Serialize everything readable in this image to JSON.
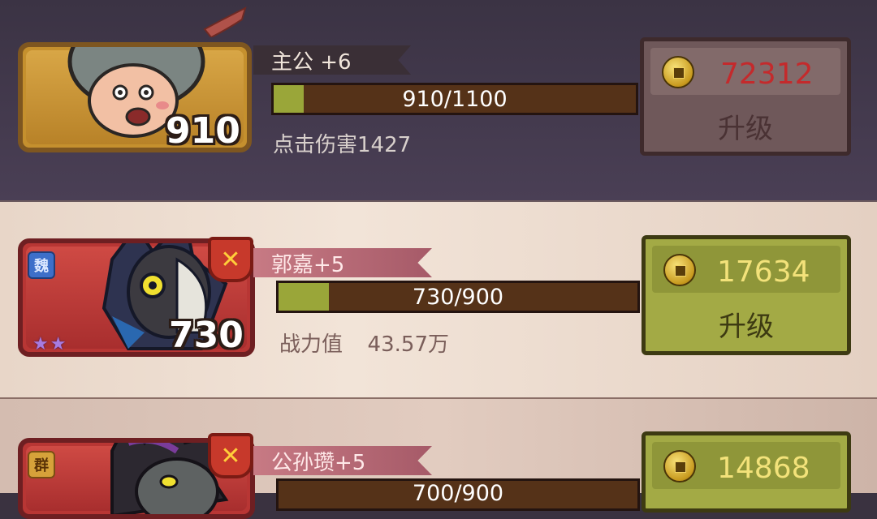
{
  "heroes": [
    {
      "name": "主公 +6",
      "level": "910",
      "progress_text": "910/1100",
      "progress": 0.0827,
      "stat_text": "点击伤害1427",
      "cost": "72312",
      "upgrade_label": "升级",
      "affordable": false
    },
    {
      "name": "郭嘉+5",
      "level": "730",
      "faction": "魏",
      "stars": 2,
      "progress_text": "730/900",
      "progress": 0.14,
      "stat_label": "战力值",
      "stat_value": "43.57万",
      "cost": "17634",
      "upgrade_label": "升级",
      "affordable": true
    },
    {
      "name": "公孙瓒+5",
      "faction": "群",
      "progress_text": "700/900",
      "cost": "14868",
      "affordable": true
    }
  ],
  "colors": {
    "bar_fill": "#9aa639",
    "bar_track": "#553218",
    "cost_unaffordable": "#c42a2c",
    "cost_affordable": "#f3e27a"
  },
  "icons": {
    "coin": "copper-coin-icon",
    "class": "crossed-swords-icon",
    "star": "star-icon"
  }
}
